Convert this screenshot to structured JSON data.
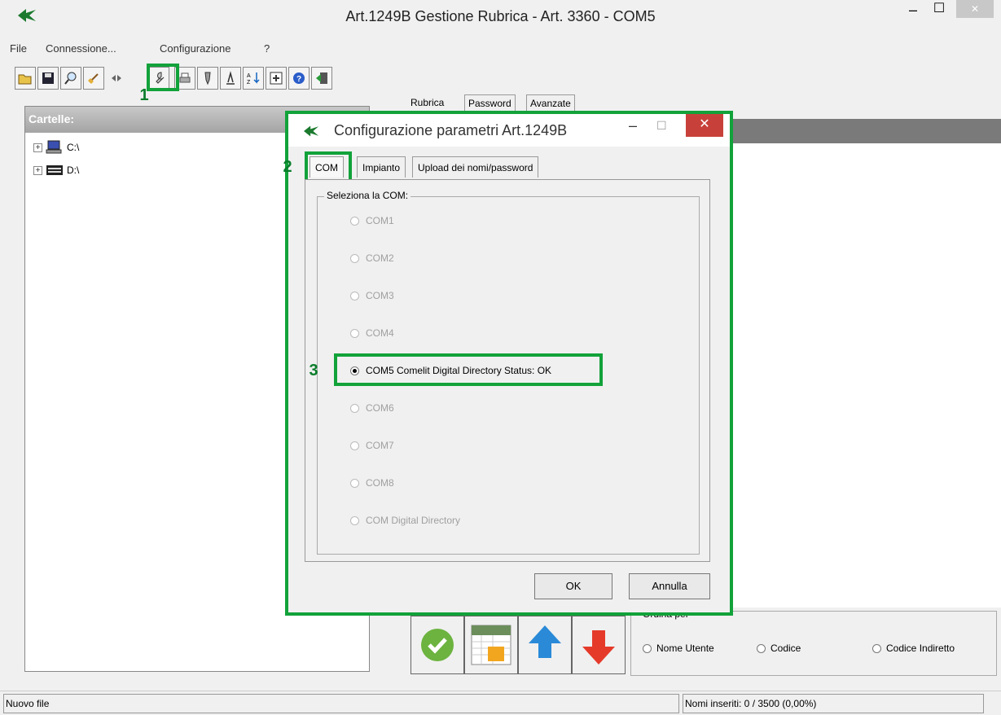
{
  "window": {
    "title": "Art.1249B Gestione Rubrica - Art. 3360 - COM5",
    "minimize": "–",
    "maximize": "☐",
    "close": "✕"
  },
  "menu": [
    "File",
    "Connessione...",
    "Configurazione",
    "?"
  ],
  "toolbar": {
    "icons": [
      "open-folder-icon",
      "save-icon",
      "find-icon",
      "broom-icon",
      "connect-icon",
      "config-wrench-icon",
      "print-icon",
      "pen-icon",
      "edit-icon",
      "sort-az-icon",
      "add-icon",
      "help-icon",
      "exit-icon"
    ]
  },
  "callouts": [
    "1",
    "2",
    "3"
  ],
  "left_panel": {
    "header": "Cartelle:",
    "drives": [
      "C:\\",
      "D:\\"
    ]
  },
  "main_tabs": [
    "Rubrica",
    "Password",
    "Avanzate"
  ],
  "dialog": {
    "title": "Configurazione parametri Art.1249B",
    "tabs": [
      "COM",
      "Impianto",
      "Upload dei nomi/password"
    ],
    "group_label": "Seleziona la COM:",
    "options": [
      "COM1",
      "COM2",
      "COM3",
      "COM4",
      "COM5  Comelit Digital Directory  Status: OK",
      "COM6",
      "COM7",
      "COM8",
      "COM Digital Directory"
    ],
    "selected": "COM5  Comelit Digital Directory  Status: OK",
    "ok": "OK",
    "cancel": "Annulla"
  },
  "sort": {
    "label": "Ordina per",
    "options": [
      "Nome Utente",
      "Codice",
      "Codice Indiretto"
    ]
  },
  "status": {
    "left": "Nuovo file",
    "right": "Nomi inseriti: 0 /  3500 (0,00%)"
  },
  "colors": {
    "accent": "#12a23a",
    "close_red": "#c7413a",
    "header_gray": "#7a7a7a"
  }
}
